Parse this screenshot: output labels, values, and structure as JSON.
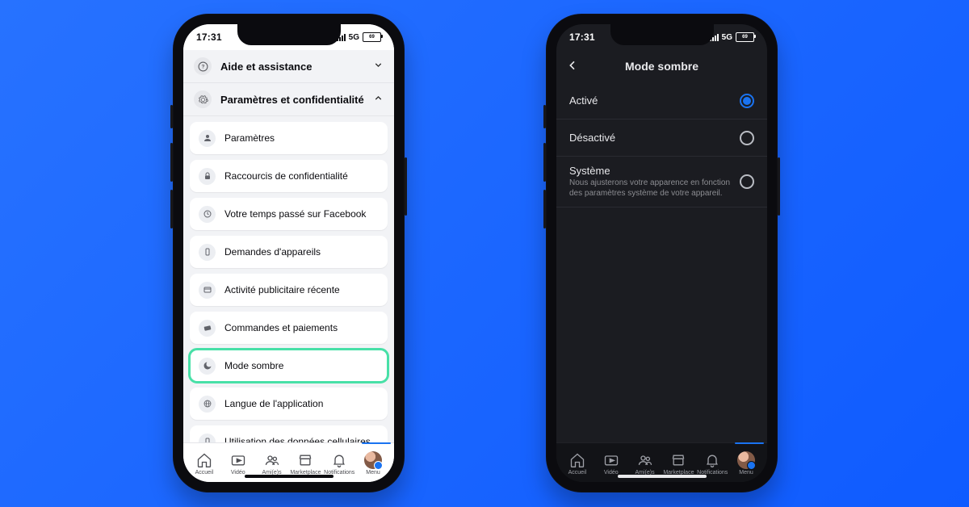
{
  "status": {
    "time": "17:31",
    "net": "5G",
    "battery_label": "69"
  },
  "light": {
    "groups": {
      "help": {
        "label": "Aide et assistance",
        "expanded": false
      },
      "settings": {
        "label": "Paramètres et confidentialité",
        "expanded": true
      }
    },
    "items": [
      {
        "label": "Paramètres",
        "icon": "user"
      },
      {
        "label": "Raccourcis de confidentialité",
        "icon": "lock"
      },
      {
        "label": "Votre temps passé sur Facebook",
        "icon": "clock"
      },
      {
        "label": "Demandes d'appareils",
        "icon": "device"
      },
      {
        "label": "Activité publicitaire récente",
        "icon": "ad"
      },
      {
        "label": "Commandes et paiements",
        "icon": "card"
      },
      {
        "label": "Mode sombre",
        "icon": "moon",
        "highlight": true
      },
      {
        "label": "Langue de l'application",
        "icon": "globe"
      },
      {
        "label": "Utilisation des données cellulaires",
        "icon": "data"
      }
    ]
  },
  "dark": {
    "title": "Mode sombre",
    "options": [
      {
        "label": "Activé",
        "selected": true
      },
      {
        "label": "Désactivé",
        "selected": false
      },
      {
        "label": "Système",
        "sub": "Nous ajusterons votre apparence en fonction des paramètres système de votre appareil.",
        "selected": false
      }
    ]
  },
  "tabs": [
    {
      "label": "Accueil",
      "icon": "home"
    },
    {
      "label": "Vidéo",
      "icon": "video"
    },
    {
      "label": "Ami(e)s",
      "icon": "friends"
    },
    {
      "label": "Marketplace",
      "icon": "market"
    },
    {
      "label": "Notifications",
      "icon": "bell"
    },
    {
      "label": "Menu",
      "icon": "avatar",
      "active": true
    }
  ]
}
